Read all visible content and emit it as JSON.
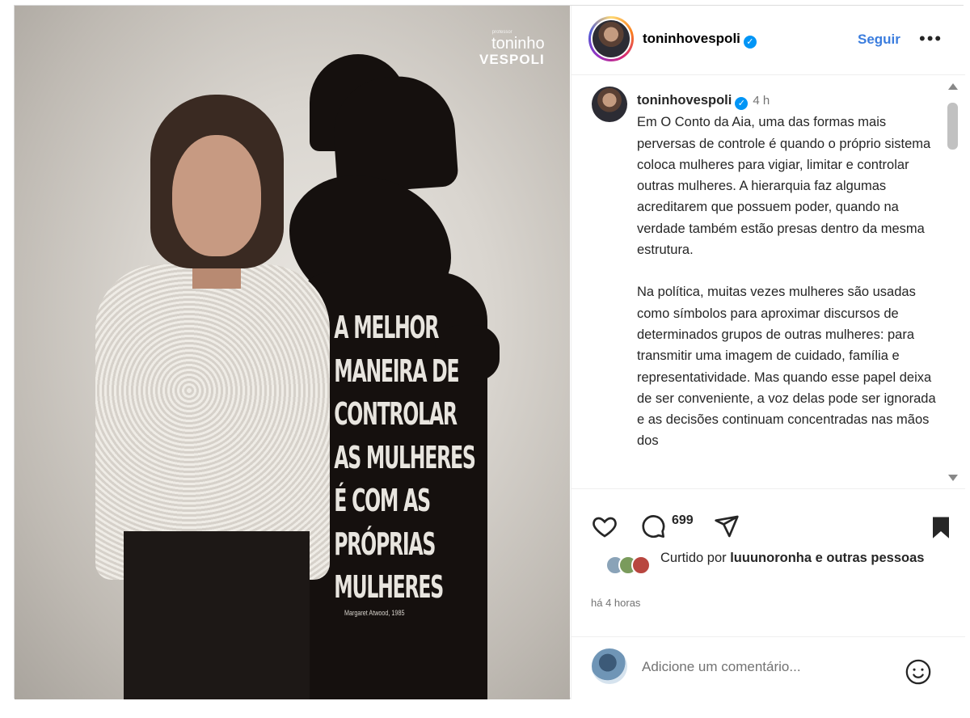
{
  "post_image": {
    "brand_small": "professor",
    "brand_name1": "toninho",
    "brand_name2": "VESPOLI",
    "headline_lines": [
      "A MELHOR",
      "MANEIRA DE",
      "CONTROLAR",
      "AS MULHERES",
      "É COM AS",
      "PRÓPRIAS",
      "MULHERES"
    ],
    "attribution": "Margaret Atwood, 1985"
  },
  "header": {
    "username": "toninhovespoli",
    "follow_label": "Seguir",
    "more_icon": "ellipsis-icon"
  },
  "caption": {
    "username": "toninhovespoli",
    "time": "4 h",
    "paragraph1": "Em O Conto da Aia, uma das formas mais perversas de controle é quando o próprio sistema coloca mulheres para vigiar, limitar e controlar outras mulheres. A hierarquia faz algumas acreditarem que possuem poder, quando na verdade também estão presas dentro da mesma estrutura.",
    "paragraph2": "Na política, muitas vezes mulheres são usadas como símbolos para aproximar discursos de determinados grupos de outras mulheres: para transmitir uma imagem de cuidado, família e representatividade. Mas quando esse papel deixa de ser conveniente, a voz delas pode ser ignorada e as decisões continuam concentradas nas mãos dos"
  },
  "actions": {
    "comment_count": "699",
    "icons": [
      "heart-icon",
      "comment-icon",
      "share-icon",
      "bookmark-icon"
    ]
  },
  "likes": {
    "prefix": "Curtido por",
    "user": "luuunoronha",
    "suffix": "e outras pessoas"
  },
  "posted_ago": "há 4 horas",
  "comment": {
    "placeholder": "Adicione um comentário..."
  },
  "colors": {
    "accent": "#0095f6",
    "follow": "#3b7dde",
    "muted": "#737373"
  }
}
